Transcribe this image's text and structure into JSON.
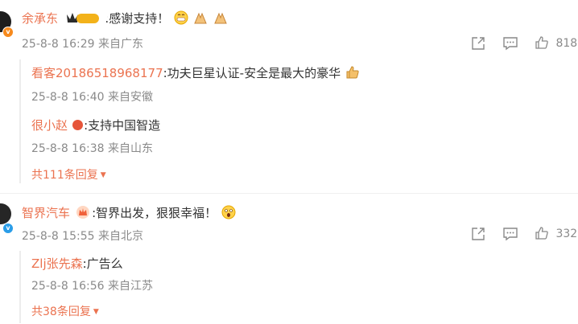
{
  "comments": [
    {
      "user": "余承东",
      "level_badge": "Ⅱ",
      "text": ":感谢支持！",
      "time": "25-8-8 16:29",
      "location": "来自广东",
      "likes": "818",
      "replies": [
        {
          "user": "看客20186518968177",
          "text": ":功夫巨星认证-安全是最大的豪华",
          "time": "25-8-8 16:40",
          "location": "来自安徽"
        },
        {
          "user": "很小赵",
          "text": ":支持中国智造",
          "time": "25-8-8 16:38",
          "location": "来自山东"
        }
      ],
      "more_replies": "共111条回复"
    },
    {
      "user": "智界汽车",
      "text": ":智界出发，狠狠幸福！",
      "time": "25-8-8 15:55",
      "location": "来自北京",
      "likes": "332",
      "replies": [
        {
          "user": "Zlj张先森",
          "text": ":广告么",
          "time": "25-8-8 16:56",
          "location": "来自江苏"
        }
      ],
      "more_replies": "共38条回复"
    }
  ],
  "icons": {
    "share": "share-icon",
    "comment": "comment-icon",
    "like": "thumbs-up-icon",
    "dropdown": "triangle-down-icon"
  },
  "colors": {
    "username": "#eb7350",
    "meta": "#8a8a8a",
    "badge_orange": "#f78a1d",
    "badge_blue": "#2a9de8"
  }
}
